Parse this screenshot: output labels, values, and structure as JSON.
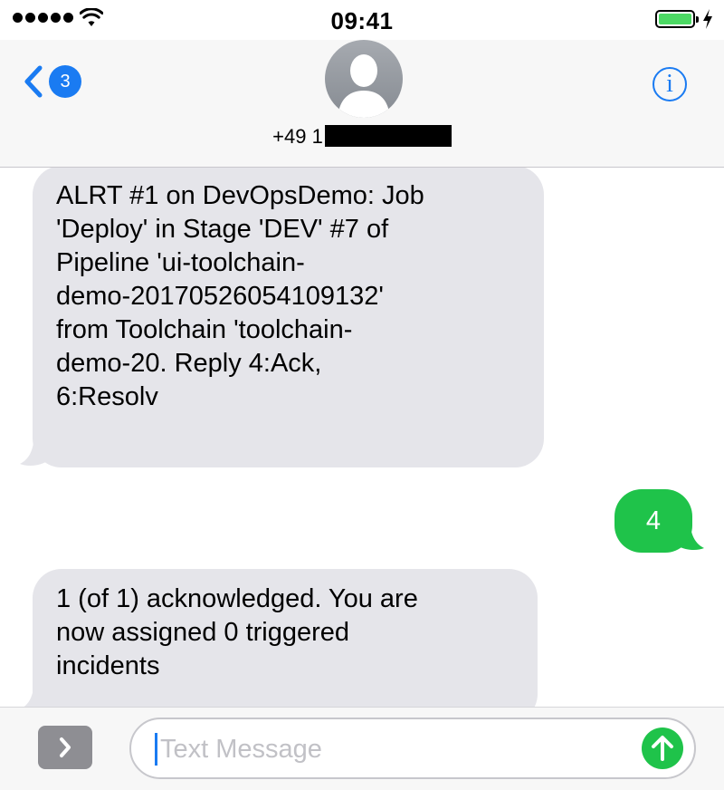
{
  "status_bar": {
    "time": "09:41",
    "signal_bars": 5,
    "battery_level": 1.0,
    "battery_color": "#4cd964"
  },
  "header": {
    "back_badge_count": "3",
    "contact_number_visible": "+49 1",
    "contact_redacted": true,
    "info_button_label": "i",
    "accent_color": "#1a7bf2"
  },
  "messages": [
    {
      "direction": "incoming",
      "lines": [
        "ALRT #1 on DevOpsDemo: Job",
        "'Deploy' in Stage 'DEV' #7 of",
        "Pipeline 'ui-toolchain-",
        "demo-20170526054109132'",
        "from Toolchain 'toolchain-",
        "demo-20. Reply 4:Ack,",
        "6:Resolv"
      ]
    },
    {
      "direction": "outgoing",
      "text": "4",
      "bubble_color": "#1fc34a"
    },
    {
      "direction": "incoming",
      "lines": [
        "1 (of 1) acknowledged. You are",
        "now assigned 0 triggered",
        "incidents"
      ]
    }
  ],
  "composer": {
    "placeholder": "Text Message",
    "apps_icon": "chevron-right-icon",
    "send_icon": "arrow-up-icon"
  }
}
